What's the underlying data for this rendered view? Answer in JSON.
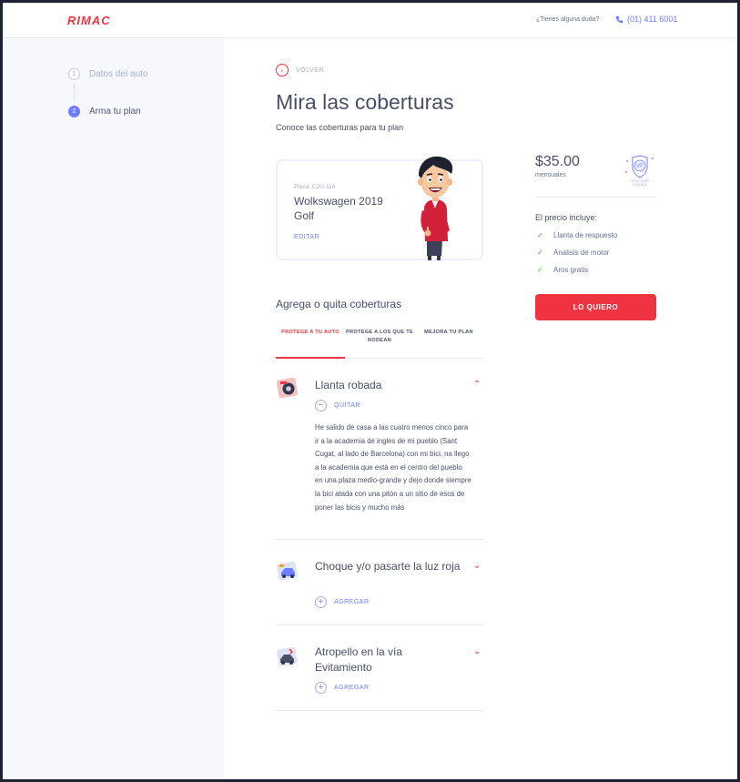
{
  "header": {
    "logo": "RIMAC",
    "help_text": "¿Tienes alguna duda?",
    "phone": "(01) 411 6001"
  },
  "sidebar": {
    "steps": [
      {
        "number": "1",
        "label": "Datos del auto"
      },
      {
        "number": "2",
        "label": "Arma tu plan"
      }
    ]
  },
  "main": {
    "back_label": "VOLVER",
    "title": "Mira las coberturas",
    "subtitle": "Conoce las coberturas para tu plan",
    "car": {
      "plate": "Placa: C2U-114",
      "name": "Wolkswagen 2019 Golf",
      "edit_label": "EDITAR"
    },
    "coverages_title": "Agrega o quita coberturas",
    "tabs": [
      {
        "label": "PROTEGE A TU AUTO"
      },
      {
        "label": "PROTEGE A LOS QUE TE RODEAN"
      },
      {
        "label": "MEJORA TU PLAN"
      }
    ],
    "coverages": [
      {
        "title": "Llanta robada",
        "action": "QUITAR",
        "description": "He salido de casa a las cuatro menos cinco para ir a la academia de ingles de mi pueblo (Sant Cugat, al lado de Barcelona) con mi bici, na llego a la academia que está en el centro del pueblo en una plaza medio-grande y dejo donde siempre la bici atada con una pitón a un sitio de esos de poner las bicis y mucho más"
      },
      {
        "title": "Choque y/o pasarte la luz roja",
        "action": "AGREGAR"
      },
      {
        "title": "Atropello en la vía Evitamiento",
        "action": "AGREGAR"
      }
    ]
  },
  "price": {
    "amount": "$35.00",
    "period": "mensuales",
    "badge_text": "VF",
    "badge_label": "VEHICULAR FLEXIBLE",
    "includes_title": "El precio incluye:",
    "includes": [
      "Llanta de respuesto",
      "Analisis de motor",
      "Aros gratis"
    ],
    "cta": "LO QUIERO"
  },
  "colors": {
    "brand_red": "#ef3340",
    "accent_blue": "#6f7dff",
    "check_green": "#43b748",
    "text_dark": "#494f66"
  }
}
